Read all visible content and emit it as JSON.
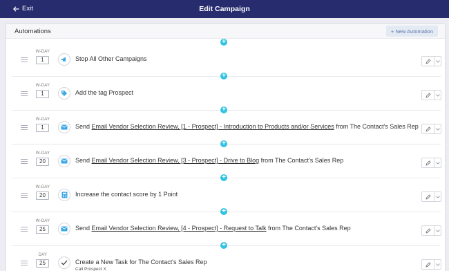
{
  "header": {
    "exit_label": "Exit",
    "title": "Edit Campaign"
  },
  "panel": {
    "title": "Automations",
    "new_button_label": "+ New Automation"
  },
  "colors": {
    "header_bg": "#262c6e",
    "accent": "#2fc3e3",
    "icon_blue": "#3ba7e6",
    "button_text": "#5b77a8"
  },
  "automations": [
    {
      "day_label": "W-DAY",
      "day": "1",
      "icon": "megaphone-icon",
      "text": "Stop All Other Campaigns",
      "link": "",
      "suffix": "",
      "subtext": ""
    },
    {
      "day_label": "W-DAY",
      "day": "1",
      "icon": "tag-icon",
      "text": "Add the tag Prospect",
      "link": "",
      "suffix": "",
      "subtext": ""
    },
    {
      "day_label": "W-DAY",
      "day": "1",
      "icon": "email-icon",
      "text": "Send ",
      "link": "Email Vendor Selection Review, [1 - Prospect] - Introduction to Products and/or Services",
      "suffix": " from The Contact's Sales Rep",
      "subtext": ""
    },
    {
      "day_label": "W-DAY",
      "day": "20",
      "icon": "email-icon",
      "text": "Send ",
      "link": "Email Vendor Selection Review, [3 - Prospect] - Drive to Blog",
      "suffix": " from The Contact's Sales Rep",
      "subtext": ""
    },
    {
      "day_label": "W-DAY",
      "day": "20",
      "icon": "calculator-icon",
      "text": "Increase the contact score by 1 Point",
      "link": "",
      "suffix": "",
      "subtext": ""
    },
    {
      "day_label": "W-DAY",
      "day": "25",
      "icon": "email-icon",
      "text": "Send ",
      "link": "Email Vendor Selection Review, [4 - Prospect] - Request to Talk",
      "suffix": " from The Contact's Sales Rep",
      "subtext": ""
    },
    {
      "day_label": "DAY",
      "day": "25",
      "icon": "checkmark-icon",
      "text": "Create a New Task for The Contact's Sales Rep",
      "link": "",
      "suffix": "",
      "subtext": "Call Prospect X"
    }
  ]
}
